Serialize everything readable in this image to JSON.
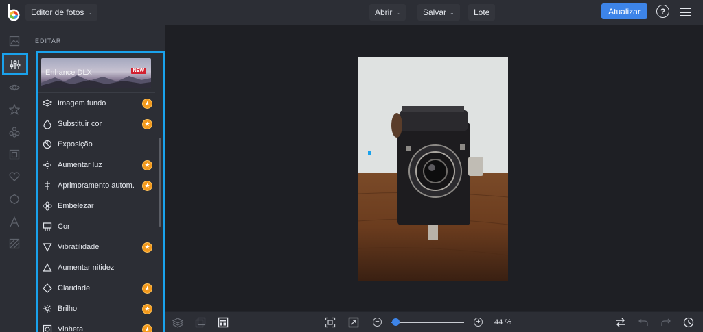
{
  "topbar": {
    "app_title": "Editor de fotos",
    "menus": [
      "Abrir",
      "Salvar",
      "Lote"
    ],
    "upgrade_label": "Atualizar",
    "help_label": "?"
  },
  "panel": {
    "section_title": "EDITAR",
    "banner": {
      "label": "Enhance DLX",
      "badge": "NEW"
    },
    "items": [
      {
        "label": "Imagem fundo",
        "icon": "layers-icon",
        "premium": true
      },
      {
        "label": "Substituir cor",
        "icon": "drop-icon",
        "premium": true
      },
      {
        "label": "Exposição",
        "icon": "exposure-icon",
        "premium": false
      },
      {
        "label": "Aumentar luz",
        "icon": "light-icon",
        "premium": true
      },
      {
        "label": "Aprimoramento autom.",
        "icon": "auto-enhance-icon",
        "premium": true
      },
      {
        "label": "Embelezar",
        "icon": "beautify-icon",
        "premium": false
      },
      {
        "label": "Cor",
        "icon": "color-icon",
        "premium": false
      },
      {
        "label": "Vibratilidade",
        "icon": "vibrance-icon",
        "premium": true
      },
      {
        "label": "Aumentar nitidez",
        "icon": "sharpen-icon",
        "premium": false
      },
      {
        "label": "Claridade",
        "icon": "clarity-icon",
        "premium": true
      },
      {
        "label": "Brilho",
        "icon": "brightness-icon",
        "premium": true
      },
      {
        "label": "Vinheta",
        "icon": "vignette-icon",
        "premium": true
      }
    ]
  },
  "bottombar": {
    "zoom": "44 %",
    "zoom_fraction": 0.04
  },
  "colors": {
    "accent": "#1aa2ec",
    "primary": "#3d84e8",
    "premium": "#f39a1d"
  }
}
